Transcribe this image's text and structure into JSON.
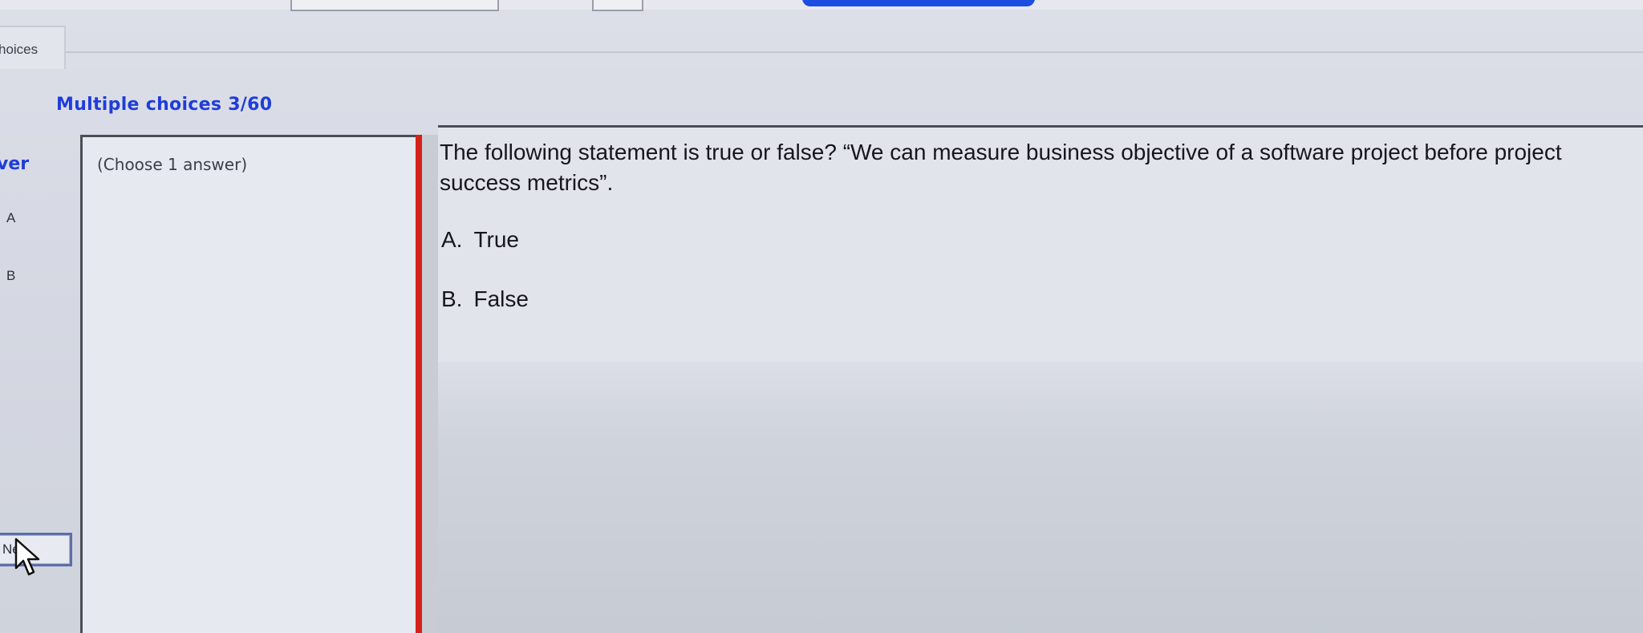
{
  "tabs": {
    "active_label": "hoices"
  },
  "section": {
    "title": "Multiple choices 3/60"
  },
  "answer_sidebar": {
    "header": "ver",
    "letters": [
      "A",
      "B"
    ],
    "next_label": "Ne"
  },
  "instruction": {
    "text": "(Choose 1 answer)"
  },
  "question": {
    "text": "The following statement is true or false? “We can measure business objective of a software project before project success metrics”.",
    "options": [
      {
        "letter": "A.",
        "label": "True"
      },
      {
        "letter": "B.",
        "label": "False"
      }
    ]
  },
  "colors": {
    "accent_blue": "#1f3dd8",
    "divider_red": "#d6201a",
    "background": "#d9dce6"
  },
  "icons": {
    "cursor": "arrow-cursor-icon"
  }
}
